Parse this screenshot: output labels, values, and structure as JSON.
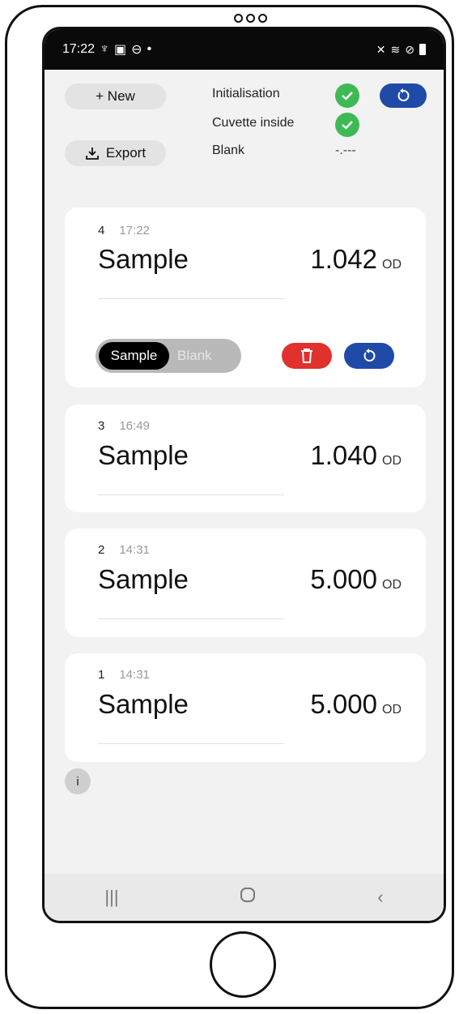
{
  "status_bar": {
    "time": "17:22",
    "left_icons": [
      "usb-icon",
      "image-icon",
      "dnd-icon",
      "dot-icon"
    ],
    "right_icons": [
      "mute-icon",
      "wifi-icon",
      "block-icon",
      "battery-icon"
    ]
  },
  "toolbar": {
    "new_label": "+ New",
    "export_label": "Export"
  },
  "device_status": {
    "initialisation_label": "Initialisation",
    "cuvette_label": "Cuvette inside",
    "blank_label": "Blank",
    "blank_value": "-.---",
    "ok_color": "#3dba56"
  },
  "measurements": [
    {
      "index": "4",
      "time": "17:22",
      "name": "Sample",
      "value": "1.042",
      "unit": "OD",
      "expanded": true
    },
    {
      "index": "3",
      "time": "16:49",
      "name": "Sample",
      "value": "1.040",
      "unit": "OD",
      "expanded": false
    },
    {
      "index": "2",
      "time": "14:31",
      "name": "Sample",
      "value": "5.000",
      "unit": "OD",
      "expanded": false
    },
    {
      "index": "1",
      "time": "14:31",
      "name": "Sample",
      "value": "5.000",
      "unit": "OD",
      "expanded": false
    }
  ],
  "card_controls": {
    "type_options": [
      "Sample",
      "Blank"
    ],
    "selected_type": "Sample",
    "delete_color": "#e0312c",
    "accent_color": "#1f4aa8"
  },
  "info_label": "i",
  "nav": {
    "recents_icon": "recents-icon",
    "home_icon": "home-icon",
    "back_icon": "back-icon"
  }
}
